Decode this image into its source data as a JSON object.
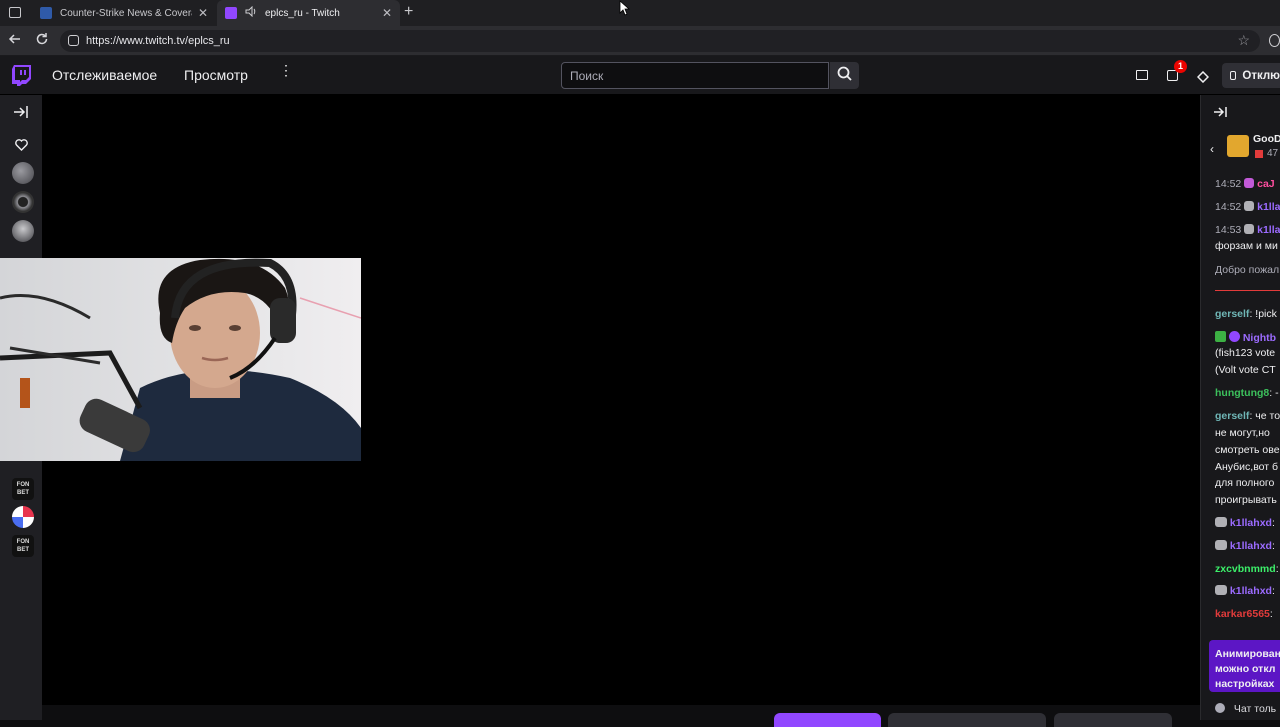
{
  "browser": {
    "tabs": [
      {
        "title": "Counter-Strike News & Coverage",
        "active": false
      },
      {
        "title": "eplcs_ru - Twitch",
        "active": true
      }
    ],
    "url": "https://www.twitch.tv/eplcs_ru"
  },
  "nav": {
    "following": "Отслеживаемое",
    "browse": "Просмотр",
    "search_placeholder": "Поиск",
    "notifications_count": "1",
    "cta_label": "Отклю"
  },
  "chat": {
    "banner_name": "GooD",
    "banner_count": "47",
    "messages": [
      {
        "time": "14:52",
        "user": "caJ",
        "color": "#ff4fa0"
      },
      {
        "time": "14:52",
        "user": "k1lla",
        "color": "#9b6bff"
      },
      {
        "time": "14:53",
        "user": "k1lla",
        "color": "#9b6bff"
      }
    ],
    "text_1": "форзам и ми",
    "system_1": "Добро пожал",
    "lines": [
      {
        "user": "gerself",
        "text": ": !pick",
        "color": "#6fb6b6"
      },
      {
        "user": "Nightb",
        "text": "",
        "color": "#9b6bff"
      },
      {
        "user": "",
        "text": "(fish123 vote",
        "color": "#efeff1"
      },
      {
        "user": "",
        "text": "(Volt vote CT",
        "color": "#efeff1"
      },
      {
        "user": "hungtung8",
        "text": ": -",
        "color": "#3cc05c"
      },
      {
        "user": "gerself",
        "text": ": че то",
        "color": "#6fb6b6"
      },
      {
        "user": "",
        "text": "не могут,но",
        "color": "#efeff1"
      },
      {
        "user": "",
        "text": "смотреть ове",
        "color": "#efeff1"
      },
      {
        "user": "",
        "text": "Анубис,вот б",
        "color": "#efeff1"
      },
      {
        "user": "",
        "text": "для полного",
        "color": "#efeff1"
      },
      {
        "user": "",
        "text": "проигрывать",
        "color": "#efeff1"
      },
      {
        "user": "k1llahxd",
        "text": ":",
        "color": "#9b6bff"
      },
      {
        "user": "k1llahxd",
        "text": ":",
        "color": "#9b6bff"
      },
      {
        "user": "zxcvbnmmd",
        "text": ":",
        "color": "#3cf06a"
      },
      {
        "user": "k1llahxd",
        "text": ":",
        "color": "#9b6bff"
      },
      {
        "user": "karkar6565",
        "text": ":",
        "color": "#e23b3b"
      }
    ],
    "promo": [
      "Анимирован",
      "можно откл",
      "настройках"
    ],
    "footer": "Чат толь"
  },
  "colors": {
    "twitch_purple": "#9147ff",
    "background": "#0e0e10",
    "chat_bg": "#18181b"
  }
}
